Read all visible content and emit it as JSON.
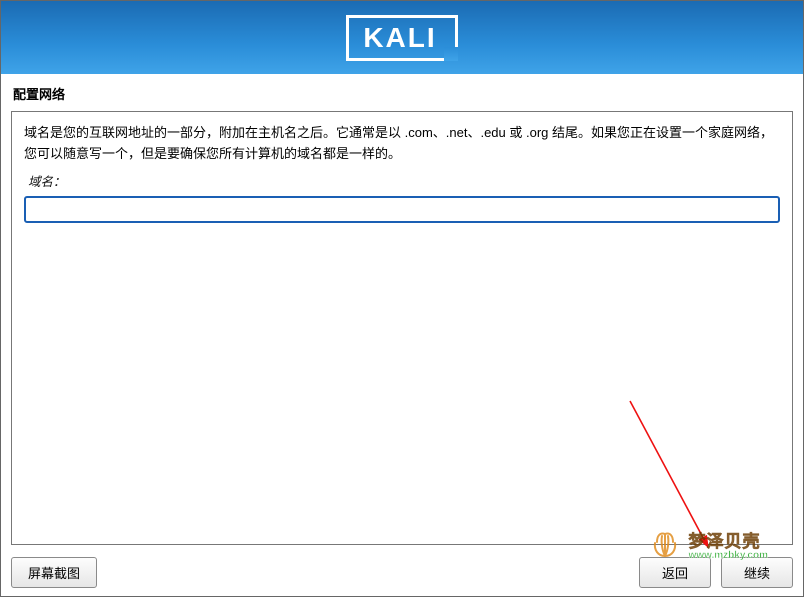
{
  "header": {
    "logo": "KALI"
  },
  "section": {
    "title": "配置网络"
  },
  "content": {
    "description": "域名是您的互联网地址的一部分，附加在主机名之后。它通常是以 .com、.net、.edu 或 .org 结尾。如果您正在设置一个家庭网络，您可以随意写一个，但是要确保您所有计算机的域名都是一样的。",
    "field_label": "域名：",
    "input_value": ""
  },
  "buttons": {
    "screenshot": "屏幕截图",
    "back": "返回",
    "continue": "继续"
  },
  "watermark": {
    "text_zh": "梦泽贝壳",
    "url": "www.mzbky.com"
  }
}
